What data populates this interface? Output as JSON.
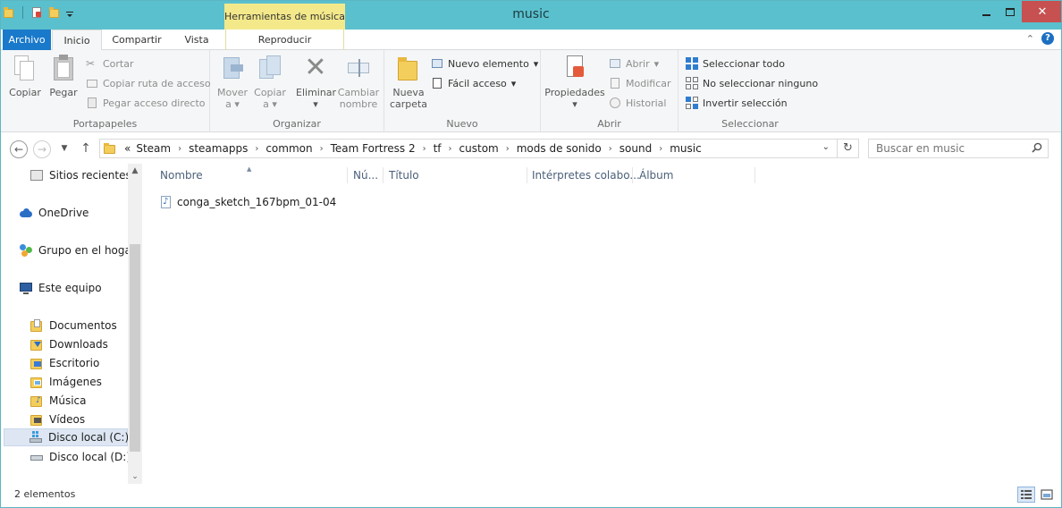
{
  "window": {
    "title": "music",
    "contextual_tab": "Herramientas de música",
    "close_glyph": "✕"
  },
  "tabs": {
    "file": "Archivo",
    "home": "Inicio",
    "share": "Compartir",
    "view": "Vista",
    "play": "Reproducir"
  },
  "ribbon": {
    "clipboard": {
      "label": "Portapapeles",
      "copy": "Copiar",
      "paste": "Pegar",
      "cut": "Cortar",
      "copy_path": "Copiar ruta de acceso",
      "paste_shortcut": "Pegar acceso directo"
    },
    "organize": {
      "label": "Organizar",
      "move_line1": "Mover",
      "move_line2": "a",
      "copy_line1": "Copiar",
      "copy_line2": "a",
      "delete": "Eliminar",
      "rename_line1": "Cambiar",
      "rename_line2": "nombre"
    },
    "new": {
      "label": "Nuevo",
      "new_folder_line1": "Nueva",
      "new_folder_line2": "carpeta",
      "new_item": "Nuevo elemento",
      "easy_access": "Fácil acceso"
    },
    "open": {
      "label": "Abrir",
      "properties": "Propiedades",
      "open": "Abrir",
      "edit": "Modificar",
      "history": "Historial"
    },
    "select": {
      "label": "Seleccionar",
      "select_all": "Seleccionar todo",
      "select_none": "No seleccionar ninguno",
      "invert": "Invertir selección"
    }
  },
  "address": {
    "overflow": "«",
    "crumbs": [
      "Steam",
      "steamapps",
      "common",
      "Team Fortress 2",
      "tf",
      "custom",
      "mods de sonido",
      "sound",
      "music"
    ],
    "search_placeholder": "Buscar en music"
  },
  "navpane": {
    "items": [
      "Sitios recientes",
      "OneDrive",
      "Grupo en el hogar",
      "Este equipo",
      "Documentos",
      "Downloads",
      "Escritorio",
      "Imágenes",
      "Música",
      "Vídeos",
      "Disco local (C:)",
      "Disco local (D:)"
    ],
    "selected": "Disco local (C:)"
  },
  "columns": {
    "name": "Nombre",
    "number": "Nú...",
    "title": "Título",
    "artists": "Intérpretes colabo...",
    "album": "Álbum"
  },
  "files": [
    {
      "name": "conga_sketch_167bpm_01-04"
    }
  ],
  "status": {
    "count": "2 elementos"
  },
  "colors": {
    "titlebar": "#5bc0cd",
    "file_tab": "#1979ca",
    "contextual_tab": "#f4e98a",
    "close_button": "#c75050"
  }
}
